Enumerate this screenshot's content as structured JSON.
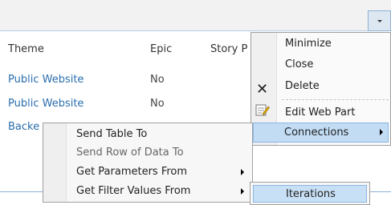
{
  "table": {
    "headers": [
      "Theme",
      "Epic",
      "Story P"
    ],
    "rows": [
      {
        "theme": "Public Website",
        "epic": "No"
      },
      {
        "theme": "Public Website",
        "epic": "No"
      },
      {
        "theme": "Backe",
        "epic": ""
      }
    ]
  },
  "webpart_menu": {
    "items": [
      "Minimize",
      "Close",
      "Delete",
      "Edit Web Part",
      "Connections"
    ],
    "icons": [
      "close-x-icon",
      "edit-web-part-icon"
    ]
  },
  "context_menu": {
    "items": [
      {
        "label": "Send Table To",
        "submenu": false,
        "disabled": false
      },
      {
        "label": "Send Row of Data To",
        "submenu": false,
        "disabled": true
      },
      {
        "label": "Get Parameters From",
        "submenu": true,
        "disabled": false
      },
      {
        "label": "Get Filter Values From",
        "submenu": true,
        "disabled": false
      }
    ]
  },
  "sub_menu": {
    "items": [
      "Iterations"
    ]
  },
  "colors": {
    "link": "#2a6ead",
    "highlight": "#c2dcf4",
    "highlight_border": "#8ab5e3",
    "header_bar": "#f2f2f2"
  }
}
